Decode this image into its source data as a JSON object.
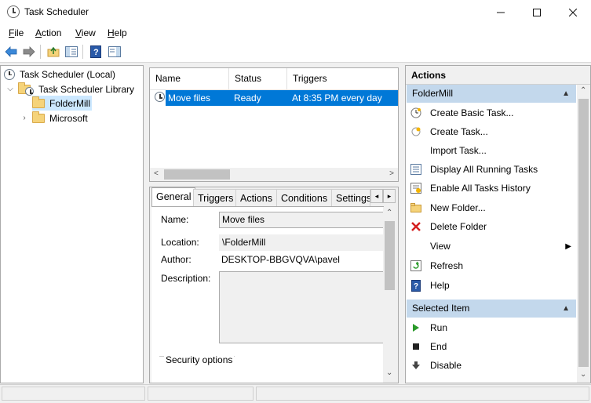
{
  "window": {
    "title": "Task Scheduler"
  },
  "menu": [
    "File",
    "Action",
    "View",
    "Help"
  ],
  "tree": {
    "root": "Task Scheduler (Local)",
    "library": "Task Scheduler Library",
    "children": [
      "FolderMill",
      "Microsoft"
    ]
  },
  "task_list": {
    "columns": [
      "Name",
      "Status",
      "Triggers"
    ],
    "rows": [
      {
        "name": "Move files",
        "status": "Ready",
        "triggers": "At 8:35 PM every day"
      }
    ]
  },
  "details": {
    "tabs": [
      "General",
      "Triggers",
      "Actions",
      "Conditions",
      "Settings"
    ],
    "name_label": "Name:",
    "name_value": "Move files",
    "location_label": "Location:",
    "location_value": "\\FolderMill",
    "author_label": "Author:",
    "author_value": "DESKTOP-BBGVQVA\\pavel",
    "description_label": "Description:",
    "description_value": "",
    "security_label": "Security options"
  },
  "actions": {
    "header": "Actions",
    "section1": "FolderMill",
    "items1": [
      {
        "label": "Create Basic Task...",
        "icon": "create-basic-task-icon"
      },
      {
        "label": "Create Task...",
        "icon": "create-task-icon"
      },
      {
        "label": "Import Task...",
        "icon": ""
      },
      {
        "label": "Display All Running Tasks",
        "icon": "running-tasks-icon"
      },
      {
        "label": "Enable All Tasks History",
        "icon": "history-icon"
      },
      {
        "label": "New Folder...",
        "icon": "new-folder-icon"
      },
      {
        "label": "Delete Folder",
        "icon": "delete-icon"
      },
      {
        "label": "View",
        "icon": ""
      },
      {
        "label": "Refresh",
        "icon": "refresh-icon"
      },
      {
        "label": "Help",
        "icon": "help-icon"
      }
    ],
    "section2": "Selected Item",
    "items2": [
      {
        "label": "Run",
        "icon": "run-icon"
      },
      {
        "label": "End",
        "icon": "end-icon"
      },
      {
        "label": "Disable",
        "icon": "disable-icon"
      }
    ]
  }
}
